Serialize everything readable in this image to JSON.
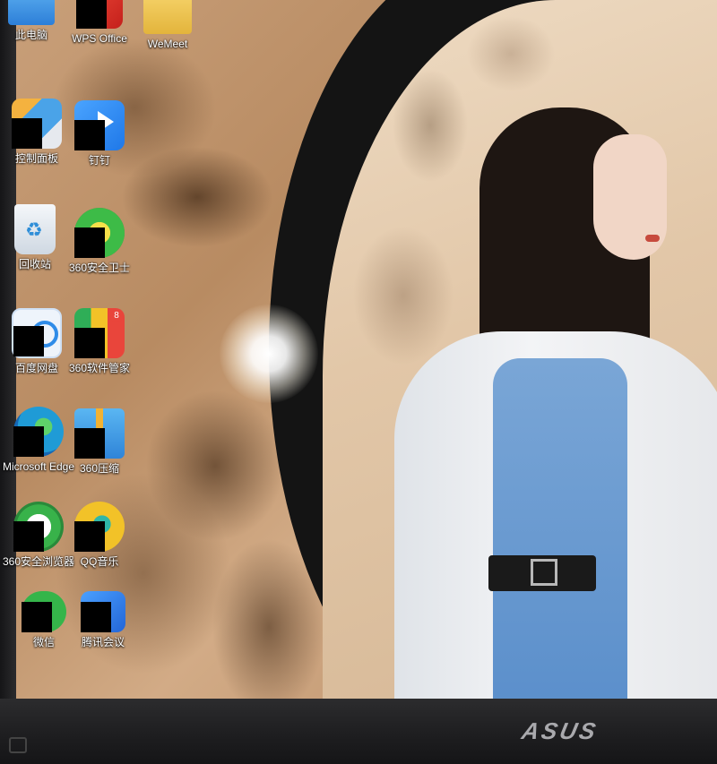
{
  "brand": "ASUS",
  "desktop_icons": [
    {
      "label": "此电脑",
      "icon": "computer-icon",
      "color": "#3a8be0"
    },
    {
      "label": "WPS Office",
      "icon": "wps-icon",
      "color": "#d9332b"
    },
    {
      "label": "WeMeet",
      "icon": "folder-icon",
      "color": "#e9c24f"
    },
    {
      "label": "控制面板",
      "icon": "control-panel-icon",
      "color": "#4aa3e8"
    },
    {
      "label": "钉钉",
      "icon": "dingtalk-icon",
      "color": "#2f8cf0"
    },
    {
      "label": "回收站",
      "icon": "recycle-bin-icon",
      "color": "#dfe7ef"
    },
    {
      "label": "360安全卫士",
      "icon": "360-security-icon",
      "color": "#3dbb47"
    },
    {
      "label": "百度网盘",
      "icon": "baidu-netdisk-icon",
      "color": "#e9f1fb"
    },
    {
      "label": "360软件管家",
      "icon": "360-software-icon",
      "color": "#2fae57",
      "badge": "8"
    },
    {
      "label": "Microsoft Edge",
      "icon": "edge-icon",
      "color": "#1f9bd6"
    },
    {
      "label": "360压缩",
      "icon": "360-zip-icon",
      "color": "#2f9be6"
    },
    {
      "label": "360安全浏览器",
      "icon": "360-browser-icon",
      "color": "#38b24a"
    },
    {
      "label": "QQ音乐",
      "icon": "qq-music-icon",
      "color": "#f2c228"
    },
    {
      "label": "微信",
      "icon": "wechat-icon",
      "color": "#35b54a"
    },
    {
      "label": "腾讯会议",
      "icon": "tencent-meeting-icon",
      "color": "#2f7fe6"
    }
  ]
}
